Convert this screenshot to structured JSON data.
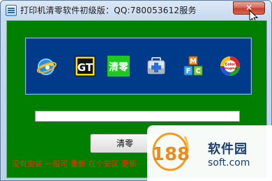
{
  "window": {
    "title": "打印机清零软件初级版：QQ:780053612服务",
    "close_label": "✕"
  },
  "toolbar": {
    "tools": [
      {
        "name": "ie-globe-icon"
      },
      {
        "name": "gt-icon",
        "label": "GT"
      },
      {
        "name": "qingling-icon",
        "label": "清零"
      },
      {
        "name": "medkit-icon"
      },
      {
        "name": "mfc-blocks-icon",
        "label": "MFC"
      },
      {
        "name": "color-imaging-icon",
        "label": "Color Imaging"
      }
    ]
  },
  "progress": {
    "value": 0
  },
  "clean_button": {
    "label": "清零"
  },
  "status": {
    "text": "没有安装 一般可 重新 在个安区 更新"
  },
  "watermark": {
    "logo": "188",
    "name": "软件园",
    "domain": "soft.com"
  },
  "colors": {
    "client_bg": "#007f00",
    "panel_bg": "#003b8b",
    "status_text": "#ff2a00",
    "progress_fill": "#06b025"
  }
}
